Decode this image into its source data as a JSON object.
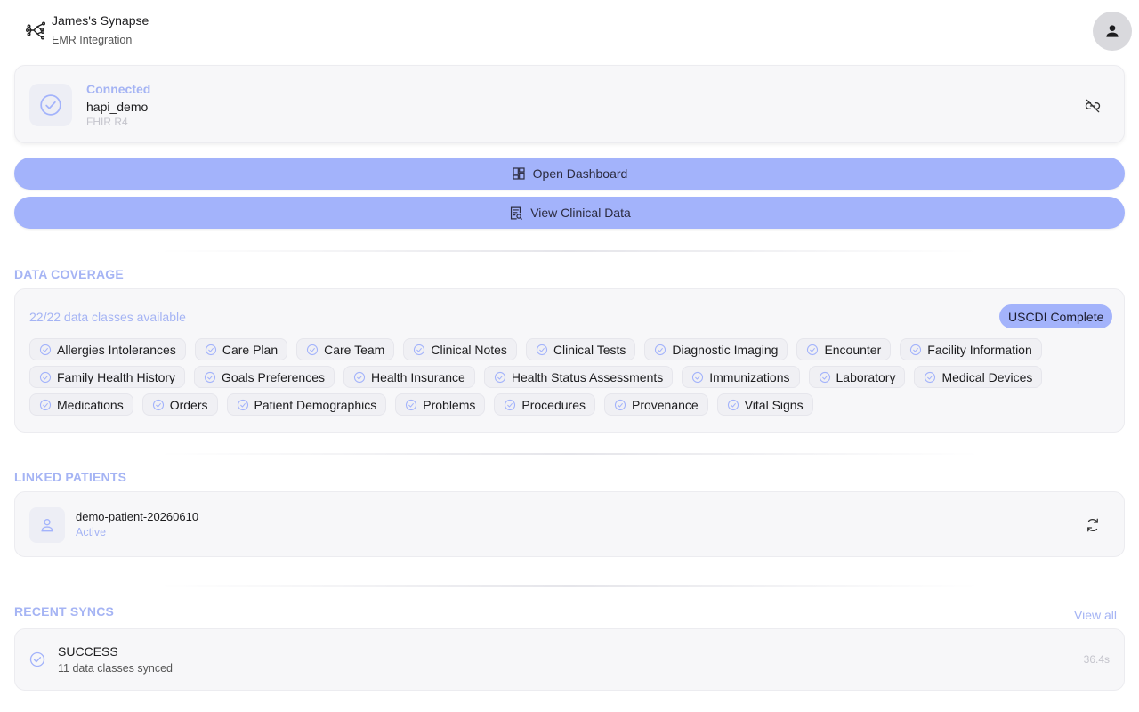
{
  "header": {
    "title": "James's Synapse",
    "subtitle": "EMR Integration",
    "logo_icon": "synapse-logo-icon",
    "account_icon": "person-icon"
  },
  "connection": {
    "status": "Connected",
    "name": "hapi_demo",
    "protocol": "FHIR R4",
    "status_icon": "check-circle-icon",
    "disconnect_icon": "link-off-icon"
  },
  "actions": {
    "dashboard_label": "Open Dashboard",
    "clinical_label": "View Clinical Data"
  },
  "coverage": {
    "section_title": "DATA COVERAGE",
    "count_text": "22/22 data classes available",
    "badge": "USCDI Complete",
    "classes": [
      "Allergies Intolerances",
      "Care Plan",
      "Care Team",
      "Clinical Notes",
      "Clinical Tests",
      "Diagnostic Imaging",
      "Encounter",
      "Facility Information",
      "Family Health History",
      "Goals Preferences",
      "Health Insurance",
      "Health Status Assessments",
      "Immunizations",
      "Laboratory",
      "Medical Devices",
      "Medications",
      "Orders",
      "Patient Demographics",
      "Problems",
      "Procedures",
      "Provenance",
      "Vital Signs"
    ]
  },
  "patients": {
    "section_title": "LINKED PATIENTS",
    "items": [
      {
        "id": "demo-patient-20260610",
        "status": "Active"
      }
    ]
  },
  "syncs": {
    "section_title": "RECENT SYNCS",
    "view_all": "View all",
    "items": [
      {
        "status": "SUCCESS",
        "description": "11 data classes synced",
        "duration": "36.4s"
      }
    ]
  },
  "colors": {
    "accent": "#a3b3fb",
    "accent_text": "#a5b4f4",
    "card_bg": "#f7f7f9"
  }
}
